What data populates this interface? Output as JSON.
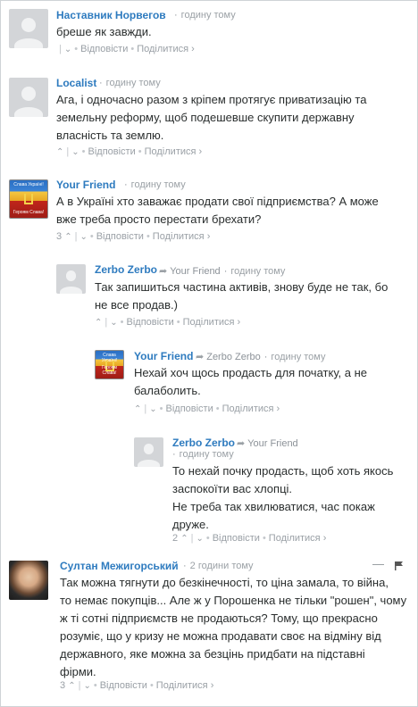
{
  "labels": {
    "reply": "Відповісти",
    "share": "Поділитися ›",
    "up": "⌃",
    "down": "⌄",
    "reply_arrow": "➦"
  },
  "comments": [
    {
      "author": "Наставник Норвегов",
      "time": "годину тому",
      "text": [
        "бреше як завжди."
      ],
      "votes": ""
    },
    {
      "author": "Localist",
      "time": "годину тому",
      "text": [
        "Ага, і одночасно разом з кріпем протягує приватизацію та",
        "земельну реформу, щоб подешевше скупити державну",
        "власність та землю."
      ],
      "votes": ""
    },
    {
      "author": "Your Friend",
      "time": "годину тому",
      "text": [
        "А в Україні хто заважає продати свої підприємства?  А може",
        "вже треба просто перестати брехати?"
      ],
      "votes": "3",
      "avatar_text": [
        "Слава Україні!",
        "Героям Слава!"
      ]
    },
    {
      "author": "Zerbo Zerbo",
      "reply_to": "Your Friend",
      "time": "годину тому",
      "text": [
        "Так запишиться частина активів, знову буде не так, бо",
        "не все продав.)"
      ],
      "votes": ""
    },
    {
      "author": "Your Friend",
      "reply_to": "Zerbo Zerbo",
      "time": "годину тому",
      "text": [
        "Нехай хоч щось продасть для початку, а не",
        "балаболить."
      ],
      "votes": "",
      "avatar_text": [
        "Слава Україні!",
        "Героям Слава!"
      ]
    },
    {
      "author": "Zerbo Zerbo",
      "reply_to": "Your Friend",
      "time": "годину тому",
      "text": [
        "То нехай почку продасть, щоб хоть якось",
        "заспокоїти вас хлопці.",
        "Не треба так хвилюватися, час покаж",
        "друже."
      ],
      "votes": "2"
    },
    {
      "author": "Султан Межигорський",
      "time": "2 години тому",
      "text": [
        "Так можна тягнути до безкінечності, то ціна замала, то війна,",
        "то немає покупців... Але ж у Порошенка не тільки \"рошен\", чому",
        "ж ті сотні підприємств не продаються? Тому, що прекрасно",
        "розуміє, що у кризу не можна продавати своє на відміну від",
        "державного, яке можна за безцінь придбати на підставні",
        "фірми."
      ],
      "votes": "3",
      "menu": "—"
    }
  ]
}
